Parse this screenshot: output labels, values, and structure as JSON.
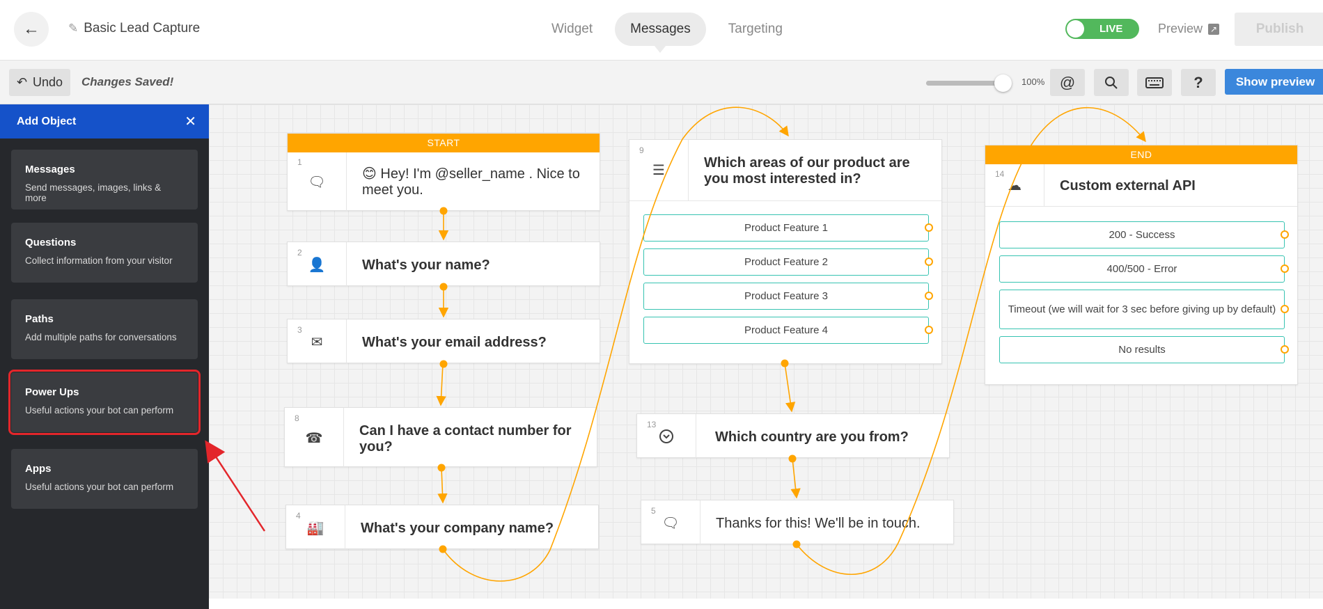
{
  "header": {
    "back_icon": "arrow-left-icon",
    "bot_title": "Basic Lead Capture",
    "tabs": [
      {
        "label": "Widget",
        "active": false
      },
      {
        "label": "Messages",
        "active": true
      },
      {
        "label": "Targeting",
        "active": false
      }
    ],
    "live_label": "LIVE",
    "preview_label": "Preview",
    "publish_label": "Publish"
  },
  "toolbar": {
    "undo_label": "Undo",
    "status_text": "Changes Saved!",
    "zoom_label": "100%",
    "zoom_value": 1.0,
    "show_preview_label": "Show preview",
    "tool_icons": [
      "at-icon",
      "search-icon",
      "keyboard-icon",
      "help-icon"
    ]
  },
  "sidebar": {
    "header": "Add Object",
    "items": [
      {
        "title": "Messages",
        "desc": "Send messages, images, links & more"
      },
      {
        "title": "Questions",
        "desc": "Collect information from your visitor"
      },
      {
        "title": "Paths",
        "desc": "Add multiple paths for conversations"
      },
      {
        "title": "Power Ups",
        "desc": "Useful actions your bot can perform",
        "highlighted": true
      },
      {
        "title": "Apps",
        "desc": "Useful actions your bot can perform"
      }
    ]
  },
  "canvas": {
    "start_label": "START",
    "end_label": "END",
    "nodes": [
      {
        "num": "1",
        "icon": "chat-icon",
        "text": "😊 Hey! I'm @seller_name . Nice to meet you."
      },
      {
        "num": "2",
        "icon": "user-icon",
        "text": "What's your name?"
      },
      {
        "num": "3",
        "icon": "envelope-icon",
        "text": "What's your email address?"
      },
      {
        "num": "8",
        "icon": "phone-icon",
        "text": "Can I have a contact number for you?"
      },
      {
        "num": "4",
        "icon": "factory-icon",
        "text": "What's your company name?"
      },
      {
        "num": "9",
        "icon": "checklist-icon",
        "text": "Which areas of our product are you most interested in?",
        "options": [
          "Product Feature 1",
          "Product Feature 2",
          "Product Feature 3",
          "Product Feature 4"
        ]
      },
      {
        "num": "13",
        "icon": "dropdown-icon",
        "text": "Which country are you from?"
      },
      {
        "num": "5",
        "icon": "chat-icon",
        "text": "Thanks for this! We'll be in touch."
      },
      {
        "num": "14",
        "icon": "cloud-icon",
        "text": "Custom external API",
        "options": [
          "200 - Success",
          "400/500 - Error",
          "Timeout (we will wait for 3 sec before giving up by default)",
          "No results"
        ]
      }
    ]
  },
  "colors": {
    "accent_orange": "#ffa500",
    "option_border": "#36c3b1",
    "sidebar_header": "#1552c9",
    "live_green": "#52b85c",
    "preview_blue": "#3b87dc",
    "highlight_red": "#e3262b"
  }
}
